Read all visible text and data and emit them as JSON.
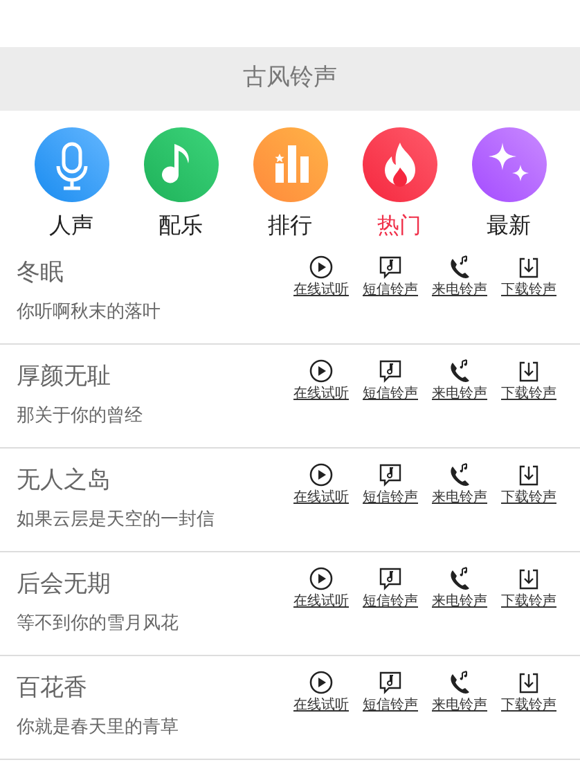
{
  "header": {
    "title": "古风铃声"
  },
  "categories": [
    {
      "label": "人声",
      "kind": "voice",
      "selected": false
    },
    {
      "label": "配乐",
      "kind": "music",
      "selected": false
    },
    {
      "label": "排行",
      "kind": "ranking",
      "selected": false
    },
    {
      "label": "热门",
      "kind": "hot",
      "selected": true
    },
    {
      "label": "最新",
      "kind": "new",
      "selected": false
    }
  ],
  "songs": [
    {
      "title": "冬眠",
      "subtitle": "你听啊秋末的落叶",
      "actions": [
        {
          "kind": "play",
          "label": "在线试听"
        },
        {
          "kind": "sms",
          "label": "短信铃声"
        },
        {
          "kind": "call",
          "label": "来电铃声"
        },
        {
          "kind": "download",
          "label": "下载铃声"
        }
      ]
    },
    {
      "title": "厚颜无耻",
      "subtitle": "那关于你的曾经",
      "actions": [
        {
          "kind": "play",
          "label": "在线试听"
        },
        {
          "kind": "sms",
          "label": "短信铃声"
        },
        {
          "kind": "call",
          "label": "来电铃声"
        },
        {
          "kind": "download",
          "label": "下载铃声"
        }
      ]
    },
    {
      "title": "无人之岛",
      "subtitle": "如果云层是天空的一封信",
      "actions": [
        {
          "kind": "play",
          "label": "在线试听"
        },
        {
          "kind": "sms",
          "label": "短信铃声"
        },
        {
          "kind": "call",
          "label": "来电铃声"
        },
        {
          "kind": "download",
          "label": "下载铃声"
        }
      ]
    },
    {
      "title": "后会无期",
      "subtitle": "等不到你的雪月风花",
      "actions": [
        {
          "kind": "play",
          "label": "在线试听"
        },
        {
          "kind": "sms",
          "label": "短信铃声"
        },
        {
          "kind": "call",
          "label": "来电铃声"
        },
        {
          "kind": "download",
          "label": "下载铃声"
        }
      ]
    },
    {
      "title": "百花香",
      "subtitle": "你就是春天里的青草",
      "actions": [
        {
          "kind": "play",
          "label": "在线试听"
        },
        {
          "kind": "sms",
          "label": "短信铃声"
        },
        {
          "kind": "call",
          "label": "来电铃声"
        },
        {
          "kind": "download",
          "label": "下载铃声"
        }
      ]
    }
  ]
}
